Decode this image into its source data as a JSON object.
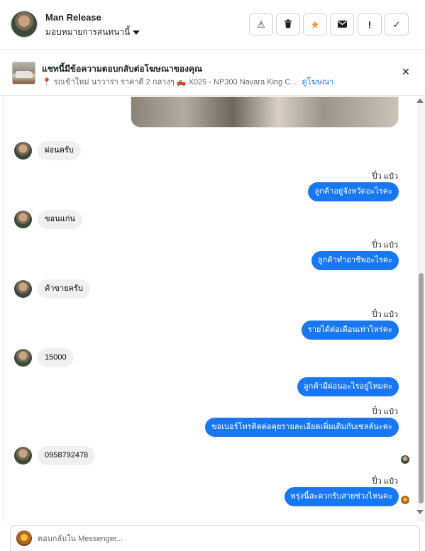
{
  "header": {
    "contact_name": "Man Release",
    "assign_label": "มอบหมายการสนทนานี้",
    "actions": [
      {
        "name": "spam-button",
        "icon": "⚠"
      },
      {
        "name": "delete-button",
        "icon": "🗑"
      },
      {
        "name": "star-button",
        "icon": "★"
      },
      {
        "name": "mark-unread-button",
        "icon": "✉"
      },
      {
        "name": "follow-up-button",
        "icon": "!"
      },
      {
        "name": "mark-done-button",
        "icon": "✓"
      }
    ]
  },
  "ad_bar": {
    "title": "แชทนี้มีข้อความตอบกลับต่อโฆษณาของคุณ",
    "pin_icon": "📍",
    "subtitle": "รถเข้าใหม่ นาวาร่า ราคาดี 2 กลางๆ 🛻 X025 - NP300 Navara King C...",
    "link": "ดูโฆษณา",
    "close_icon": "✕"
  },
  "messages": [
    {
      "dir": "in",
      "text": "ผ่อนครับ"
    },
    {
      "dir": "out",
      "sender": "ปิ๋ว แป๋ว",
      "text": "ลูกค้าอยู่จังหวัดอะไรคะ"
    },
    {
      "dir": "in",
      "text": "ขอนแก่น"
    },
    {
      "dir": "out",
      "sender": "ปิ๋ว แป๋ว",
      "text": "ลูกค้าทำอาชีพอะไรคะ"
    },
    {
      "dir": "in",
      "text": "ค้าขายครับ"
    },
    {
      "dir": "out",
      "sender": "ปิ๋ว แป๋ว",
      "text": "รายได้ต่อเดือนเท่าไหร่คะ"
    },
    {
      "dir": "in",
      "text": "15000"
    },
    {
      "dir": "out",
      "text": "ลูกค้ามีผ่อนอะไรอยู่ไหมคะ"
    },
    {
      "dir": "out",
      "sender": "ปิ๋ว แป๋ว",
      "text": "ขอเบอร์โทรติดต่อคุยรายละเอียดเพิ่มเติมกับเซลล์นะคะ"
    },
    {
      "dir": "in",
      "text": "0958792478"
    },
    {
      "dir": "out",
      "sender": "ปิ๋ว แป๋ว",
      "text": "พรุ่งนี้สะดวกรับสายช่วงไหนคะ"
    }
  ],
  "composer": {
    "placeholder": "ตอบกลับใน Messenger..."
  },
  "colors": {
    "outgoing_bubble": "#1877f2",
    "incoming_bubble": "#f0f0f0",
    "link": "#1b74e4",
    "star": "#f7923a"
  }
}
